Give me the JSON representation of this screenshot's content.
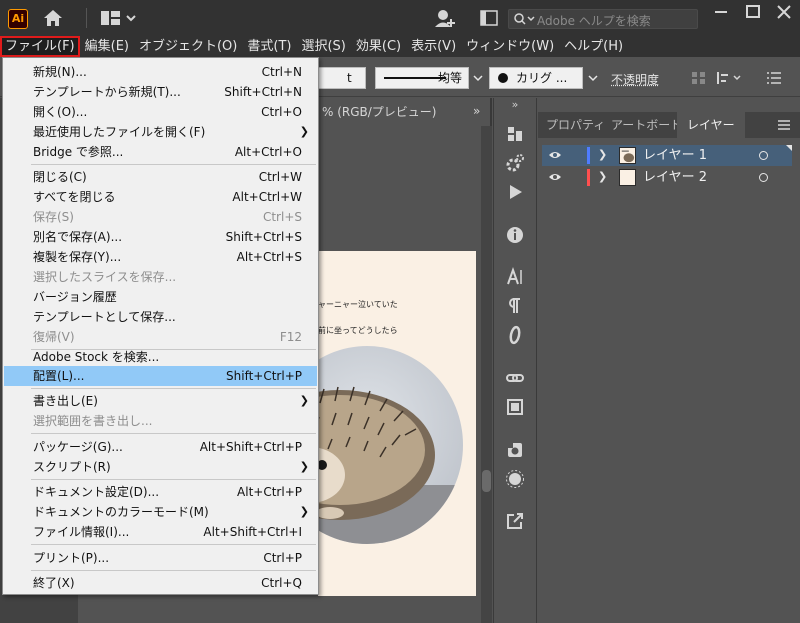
{
  "app": {
    "logo_text": "Ai",
    "help_search_placeholder": "Adobe ヘルプを検索"
  },
  "menubar": [
    {
      "label": "ファイル(F)",
      "active": true
    },
    {
      "label": "編集(E)"
    },
    {
      "label": "オブジェクト(O)"
    },
    {
      "label": "書式(T)"
    },
    {
      "label": "選択(S)"
    },
    {
      "label": "効果(C)"
    },
    {
      "label": "表示(V)"
    },
    {
      "label": "ウィンドウ(W)"
    },
    {
      "label": "ヘルプ(H)"
    }
  ],
  "controlbar": {
    "partial_left": "t",
    "stroke_profile": "均等",
    "brush": "カリグ ...",
    "opacity_label": "不透明度"
  },
  "document": {
    "tab_label": "% (RGB/プレビュー)",
    "artboard_text_1": "ャーニャー泣いていた",
    "artboard_text_2": "前に坐ってどうしたら"
  },
  "layers_panel": {
    "tabs": [
      "プロパティ",
      "アートボード",
      "レイヤー"
    ],
    "active_tab": "レイヤー",
    "layers": [
      {
        "name": "レイヤー 1",
        "color": "#4f7cff",
        "selected": true
      },
      {
        "name": "レイヤー 2",
        "color": "#ff4f4f",
        "selected": false
      }
    ]
  },
  "file_menu": {
    "items": [
      {
        "label": "新規(N)...",
        "shortcut": "Ctrl+N"
      },
      {
        "label": "テンプレートから新規(T)...",
        "shortcut": "Shift+Ctrl+N"
      },
      {
        "label": "開く(O)...",
        "shortcut": "Ctrl+O"
      },
      {
        "label": "最近使用したファイルを開く(F)",
        "submenu": true
      },
      {
        "label": "Bridge で参照...",
        "shortcut": "Alt+Ctrl+O"
      },
      {
        "label": "閉じる(C)",
        "shortcut": "Ctrl+W"
      },
      {
        "label": "すべてを閉じる",
        "shortcut": "Alt+Ctrl+W"
      },
      {
        "label": "保存(S)",
        "shortcut": "Ctrl+S",
        "disabled": true
      },
      {
        "label": "別名で保存(A)...",
        "shortcut": "Shift+Ctrl+S"
      },
      {
        "label": "複製を保存(Y)...",
        "shortcut": "Alt+Ctrl+S"
      },
      {
        "label": "選択したスライスを保存...",
        "disabled": true
      },
      {
        "label": "バージョン履歴"
      },
      {
        "label": "テンプレートとして保存..."
      },
      {
        "label": "復帰(V)",
        "shortcut": "F12",
        "disabled": true
      },
      {
        "label": "Adobe Stock を検索..."
      },
      {
        "label": "配置(L)...",
        "shortcut": "Shift+Ctrl+P",
        "highlighted": true
      },
      {
        "label": "書き出し(E)",
        "submenu": true
      },
      {
        "label": "選択範囲を書き出し...",
        "disabled": true
      },
      {
        "label": "パッケージ(G)...",
        "shortcut": "Alt+Shift+Ctrl+P"
      },
      {
        "label": "スクリプト(R)",
        "submenu": true
      },
      {
        "label": "ドキュメント設定(D)...",
        "shortcut": "Alt+Ctrl+P"
      },
      {
        "label": "ドキュメントのカラーモード(M)",
        "submenu": true
      },
      {
        "label": "ファイル情報(I)...",
        "shortcut": "Alt+Shift+Ctrl+I"
      },
      {
        "label": "プリント(P)...",
        "shortcut": "Ctrl+P"
      },
      {
        "label": "終了(X)",
        "shortcut": "Ctrl+Q"
      }
    ]
  },
  "colors": {
    "menu_highlight": "#91c9f7",
    "active_menu_outline": "#e01b1b",
    "layer_selection": "#46607a",
    "artboard": "#faf0e4"
  }
}
